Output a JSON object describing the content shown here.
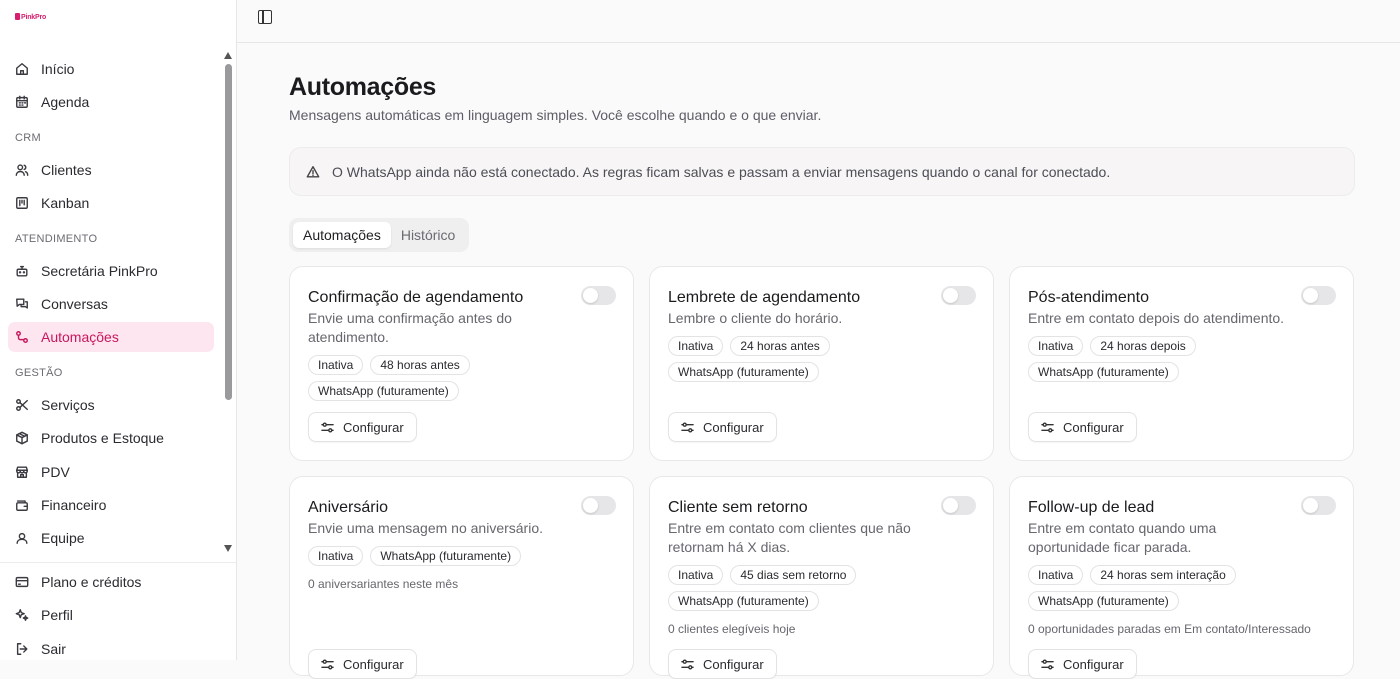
{
  "app": {
    "logo": "PinkPro"
  },
  "sidebar": {
    "top_items": [
      {
        "label": "Início",
        "icon": "home-icon"
      },
      {
        "label": "Agenda",
        "icon": "calendar-icon"
      }
    ],
    "sections": [
      {
        "title": "CRM",
        "items": [
          {
            "label": "Clientes",
            "icon": "users-icon"
          },
          {
            "label": "Kanban",
            "icon": "kanban-icon"
          }
        ]
      },
      {
        "title": "ATENDIMENTO",
        "items": [
          {
            "label": "Secretária PinkPro",
            "icon": "bot-icon"
          },
          {
            "label": "Conversas",
            "icon": "chat-icon"
          },
          {
            "label": "Automações",
            "icon": "workflow-icon"
          }
        ]
      },
      {
        "title": "GESTÃO",
        "items": [
          {
            "label": "Serviços",
            "icon": "scissors-icon"
          },
          {
            "label": "Produtos e Estoque",
            "icon": "package-icon"
          },
          {
            "label": "PDV",
            "icon": "store-icon"
          },
          {
            "label": "Financeiro",
            "icon": "wallet-icon"
          },
          {
            "label": "Equipe",
            "icon": "team-icon"
          }
        ]
      }
    ],
    "active": "Automações",
    "footer": [
      {
        "label": "Plano e créditos",
        "icon": "credit-card-icon"
      },
      {
        "label": "Perfil",
        "icon": "sparkles-icon"
      },
      {
        "label": "Sair",
        "icon": "logout-icon"
      }
    ]
  },
  "page": {
    "title": "Automações",
    "subtitle": "Mensagens automáticas em linguagem simples. Você escolhe quando e o que enviar.",
    "alert": "O WhatsApp ainda não está conectado. As regras ficam salvas e passam a enviar mensagens quando o canal for conectado.",
    "tabs": [
      "Automações",
      "Histórico"
    ],
    "active_tab": "Automações"
  },
  "cards": [
    {
      "title": "Confirmação de agendamento",
      "desc": "Envie uma confirmação antes do atendimento.",
      "badges": [
        "Inativa",
        "48 horas antes",
        "WhatsApp (futuramente)"
      ],
      "note": "",
      "button": "Configurar",
      "enabled": false
    },
    {
      "title": "Lembrete de agendamento",
      "desc": "Lembre o cliente do horário.",
      "badges": [
        "Inativa",
        "24 horas antes",
        "WhatsApp (futuramente)"
      ],
      "note": "",
      "button": "Configurar",
      "enabled": false
    },
    {
      "title": "Pós-atendimento",
      "desc": "Entre em contato depois do atendimento.",
      "badges": [
        "Inativa",
        "24 horas depois",
        "WhatsApp (futuramente)"
      ],
      "note": "",
      "button": "Configurar",
      "enabled": false
    },
    {
      "title": "Aniversário",
      "desc": "Envie uma mensagem no aniversário.",
      "badges": [
        "Inativa",
        "WhatsApp (futuramente)"
      ],
      "note": "0 aniversariantes neste mês",
      "button": "Configurar",
      "enabled": false
    },
    {
      "title": "Cliente sem retorno",
      "desc": "Entre em contato com clientes que não retornam há X dias.",
      "badges": [
        "Inativa",
        "45 dias sem retorno",
        "WhatsApp (futuramente)"
      ],
      "note": "0 clientes elegíveis hoje",
      "button": "Configurar",
      "enabled": false
    },
    {
      "title": "Follow-up de lead",
      "desc": "Entre em contato quando uma oportunidade ficar parada.",
      "badges": [
        "Inativa",
        "24 horas sem interação",
        "WhatsApp (futuramente)"
      ],
      "note": "0 oportunidades paradas em Em contato/Interessado",
      "button": "Configurar",
      "enabled": false
    }
  ],
  "colors": {
    "accent": "#c8175f",
    "active_bg": "#fde6ef"
  }
}
